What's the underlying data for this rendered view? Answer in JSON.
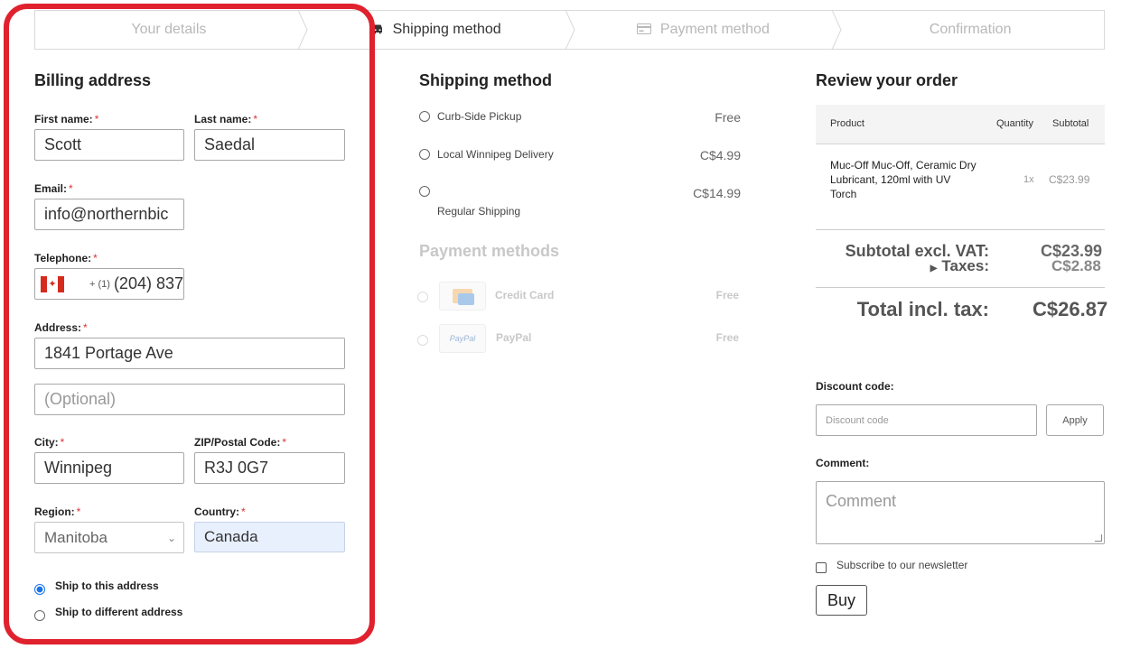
{
  "steps": [
    {
      "label": "Your details",
      "icon": "",
      "active": false
    },
    {
      "label": "Shipping method",
      "icon": "car-icon",
      "active": true
    },
    {
      "label": "Payment method",
      "icon": "credit-card-icon",
      "active": false
    },
    {
      "label": "Confirmation",
      "icon": "",
      "active": false
    }
  ],
  "billing": {
    "heading": "Billing address",
    "required_mark": "*",
    "first_name": {
      "label": "First name:",
      "value": "Scott"
    },
    "last_name": {
      "label": "Last name:",
      "value": "Saedal"
    },
    "email": {
      "label": "Email:",
      "value": "info@northernbic"
    },
    "telephone": {
      "label": "Telephone:",
      "country_flag": "canada-flag-icon",
      "dial_code": "+ (1)",
      "value": "(204) 837"
    },
    "address": {
      "label": "Address:",
      "value": "1841 Portage Ave",
      "line2_placeholder": "(Optional)"
    },
    "city": {
      "label": "City:",
      "value": "Winnipeg"
    },
    "zip": {
      "label": "ZIP/Postal Code:",
      "value": "R3J 0G7"
    },
    "region": {
      "label": "Region:",
      "value": "Manitoba"
    },
    "country": {
      "label": "Country:",
      "value": "Canada"
    },
    "ship_options": [
      {
        "label": "Ship to this address",
        "checked": true
      },
      {
        "label": "Ship to different address",
        "checked": false
      }
    ]
  },
  "shipping": {
    "heading": "Shipping method",
    "methods": [
      {
        "name": "Curb-Side Pickup",
        "price": "Free"
      },
      {
        "name": "Local Winnipeg Delivery",
        "price": "C$4.99"
      },
      {
        "name": "Regular Shipping",
        "price": "C$14.99"
      }
    ]
  },
  "payment": {
    "heading": "Payment methods",
    "methods": [
      {
        "name": "Credit Card",
        "price": "Free",
        "logo_text": ""
      },
      {
        "name": "PayPal",
        "price": "Free",
        "logo_text": "PayPal"
      }
    ]
  },
  "review": {
    "heading": "Review your order",
    "columns": {
      "product": "Product",
      "quantity": "Quantity",
      "subtotal": "Subtotal"
    },
    "items": [
      {
        "name": "Muc-Off Muc-Off, Ceramic Dry Lubricant, 120ml with UV Torch",
        "qty": "1x",
        "subtotal": "C$23.99"
      }
    ],
    "subtotal_label": "Subtotal excl. VAT:",
    "subtotal_value": "C$23.99",
    "taxes_label": "Taxes:",
    "taxes_value": "C$2.88",
    "total_label": "Total incl. tax:",
    "total_value": "C$26.87"
  },
  "discount": {
    "label": "Discount code:",
    "placeholder": "Discount code",
    "apply_label": "Apply"
  },
  "comment": {
    "label": "Comment:",
    "placeholder": "Comment"
  },
  "newsletter": {
    "label": "Subscribe to our newsletter"
  },
  "buy_label": "Buy",
  "colors": {
    "highlight": "#e0212e",
    "radio_checked": "#1a73e8",
    "autofill_bg": "#e8f0fe"
  }
}
